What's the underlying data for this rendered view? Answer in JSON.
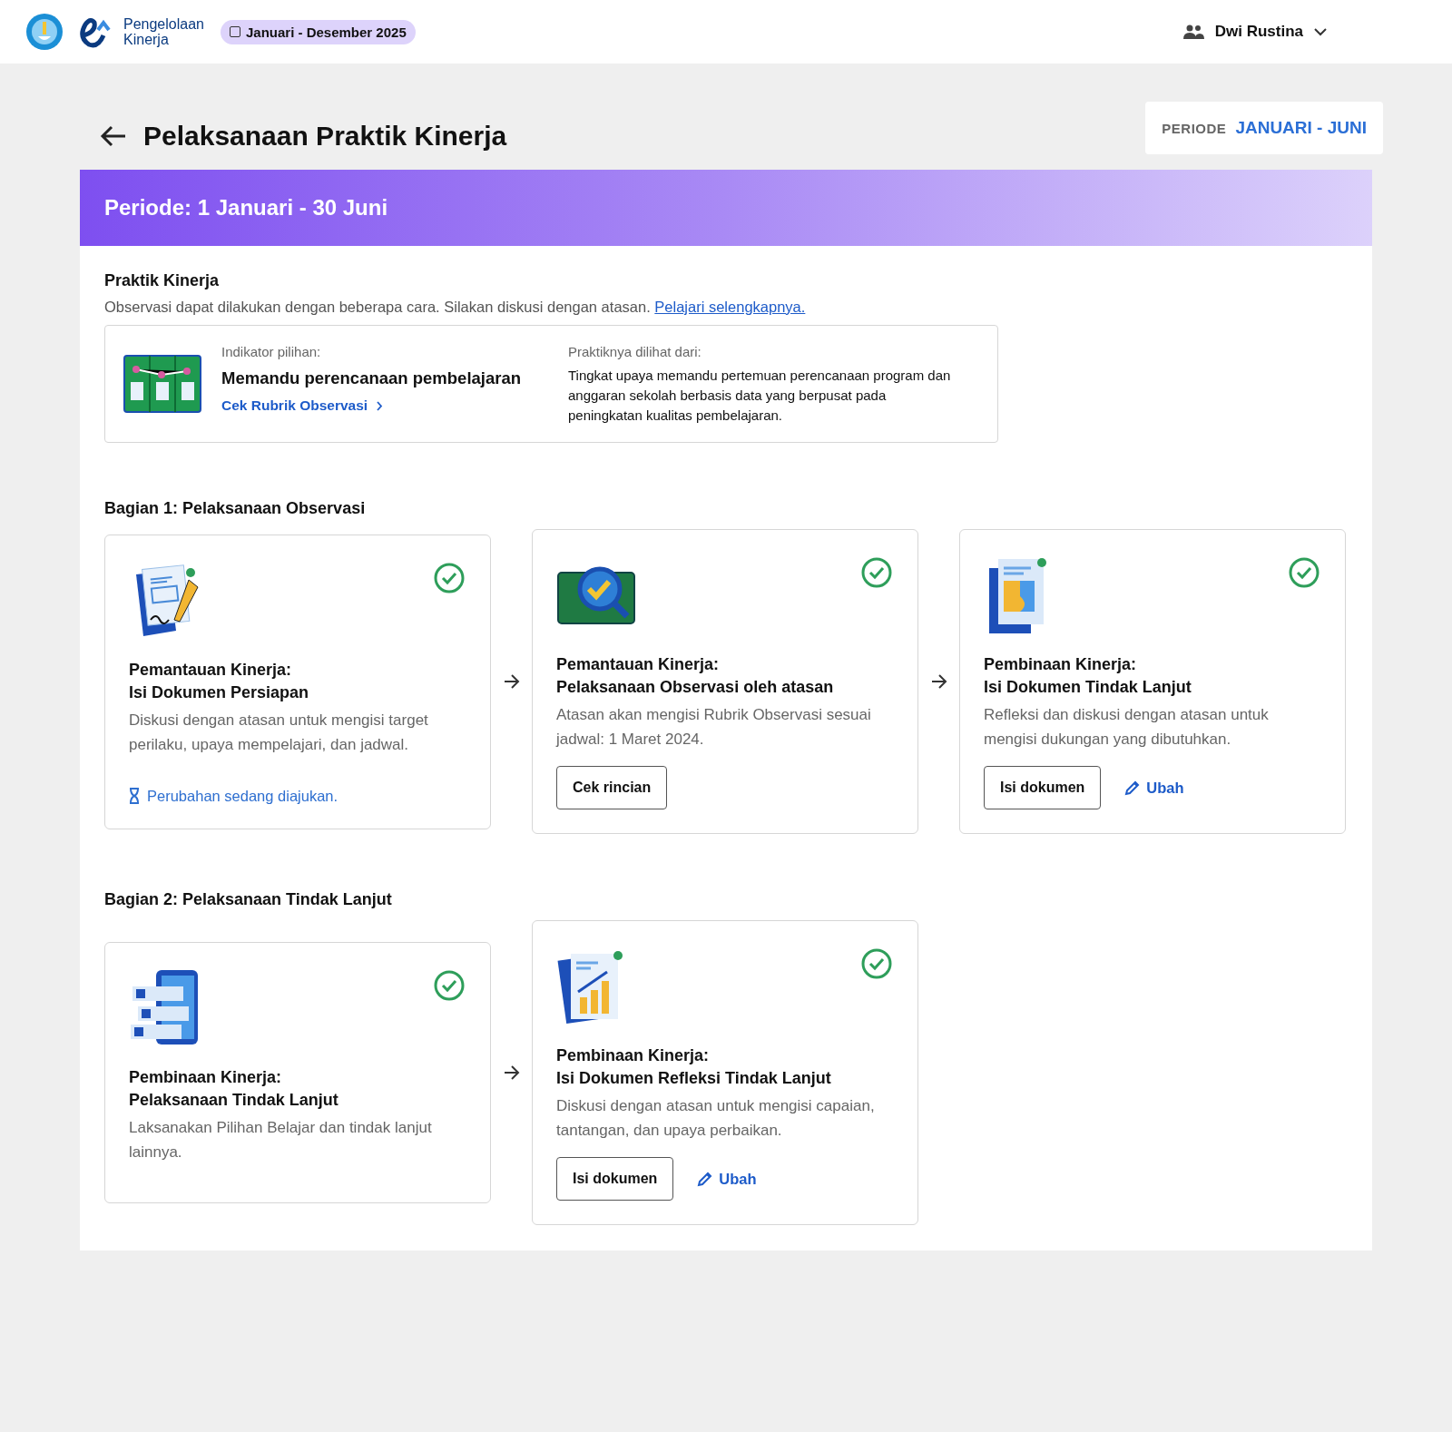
{
  "header": {
    "logo_text": [
      "Pengelolaan",
      "Kinerja"
    ],
    "period_chip": "Januari - Desember 2025",
    "user_name": "Dwi Rustina"
  },
  "page": {
    "title": "Pelaksanaan Praktik Kinerja",
    "period_label": "PERIODE",
    "period_value": "JANUARI - JUNI"
  },
  "banner": {
    "title": "Periode: 1 Januari - 30 Juni"
  },
  "practice": {
    "heading": "Praktik Kinerja",
    "description": "Observasi dapat dilakukan dengan beberapa cara. Silakan diskusi dengan atasan.",
    "link": "Pelajari selengkapnya.",
    "indicator_label": "Indikator pilihan:",
    "indicator_value": "Memandu perencanaan pembelajaran",
    "rubric_link": "Cek Rubrik Observasi",
    "seen_label": "Praktiknya dilihat dari:",
    "seen_text": "Tingkat upaya memandu pertemuan perencanaan program dan anggaran sekolah berbasis data yang berpusat pada peningkatan kualitas pembelajaran."
  },
  "sections": [
    {
      "title": "Bagian 1: Pelaksanaan Observasi",
      "steps": [
        {
          "kind": "form",
          "title": "Pemantauan Kinerja:",
          "subtitle": "Isi Dokumen Persiapan",
          "description": "Diskusi dengan atasan untuk mengisi target perilaku, upaya mempelajari, dan jadwal.",
          "done": true,
          "actions": [
            {
              "kind": "pending",
              "label": "Perubahan sedang diajukan."
            }
          ]
        },
        {
          "kind": "magnifier",
          "title": "Pemantauan Kinerja:",
          "subtitle": "Pelaksanaan Observasi oleh atasan",
          "description": "Atasan akan mengisi Rubrik Observasi sesuai jadwal: 1 Maret 2024.",
          "done": true,
          "actions": [
            {
              "kind": "button",
              "label": "Cek rincian"
            }
          ]
        },
        {
          "kind": "profile",
          "title": "Pembinaan Kinerja:",
          "subtitle": "Isi Dokumen Tindak Lanjut",
          "description": "Refleksi dan diskusi dengan atasan untuk mengisi dukungan yang dibutuhkan.",
          "done": true,
          "actions": [
            {
              "kind": "button",
              "label": "Isi dokumen"
            },
            {
              "kind": "edit",
              "label": "Ubah"
            }
          ]
        }
      ]
    },
    {
      "title": "Bagian 2: Pelaksanaan Tindak Lanjut",
      "steps": [
        {
          "kind": "checklist",
          "title": "Pembinaan Kinerja:",
          "subtitle": "Pelaksanaan Tindak Lanjut",
          "description": "Laksanakan Pilihan Belajar dan tindak lanjut lainnya.",
          "done": true
        },
        {
          "kind": "chart",
          "title": "Pembinaan Kinerja:",
          "subtitle": "Isi Dokumen Refleksi Tindak Lanjut",
          "description": "Diskusi dengan atasan untuk mengisi capaian, tantangan, dan upaya perbaikan.",
          "done": true,
          "actions": [
            {
              "kind": "button",
              "label": "Isi dokumen"
            },
            {
              "kind": "edit",
              "label": "Ubah"
            }
          ]
        }
      ]
    }
  ]
}
